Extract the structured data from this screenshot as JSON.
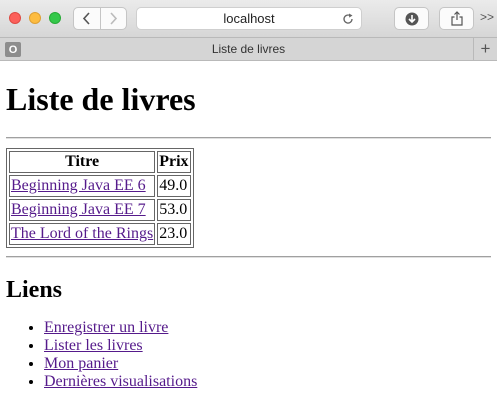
{
  "browser": {
    "url": "localhost",
    "tab_title": "Liste de livres",
    "favicon_letter": "O",
    "new_tab": "+",
    "more": ">>"
  },
  "page": {
    "title": "Liste de livres",
    "table": {
      "headers": [
        "Titre",
        "Prix"
      ],
      "rows": [
        {
          "title": "Beginning Java EE 6",
          "price": "49.0"
        },
        {
          "title": "Beginning Java EE 7",
          "price": "53.0"
        },
        {
          "title": "The Lord of the Rings",
          "price": "23.0"
        }
      ]
    },
    "links_heading": "Liens",
    "links": [
      "Enregistrer un livre",
      "Lister les livres",
      "Mon panier",
      "Dernières visualisations"
    ]
  }
}
